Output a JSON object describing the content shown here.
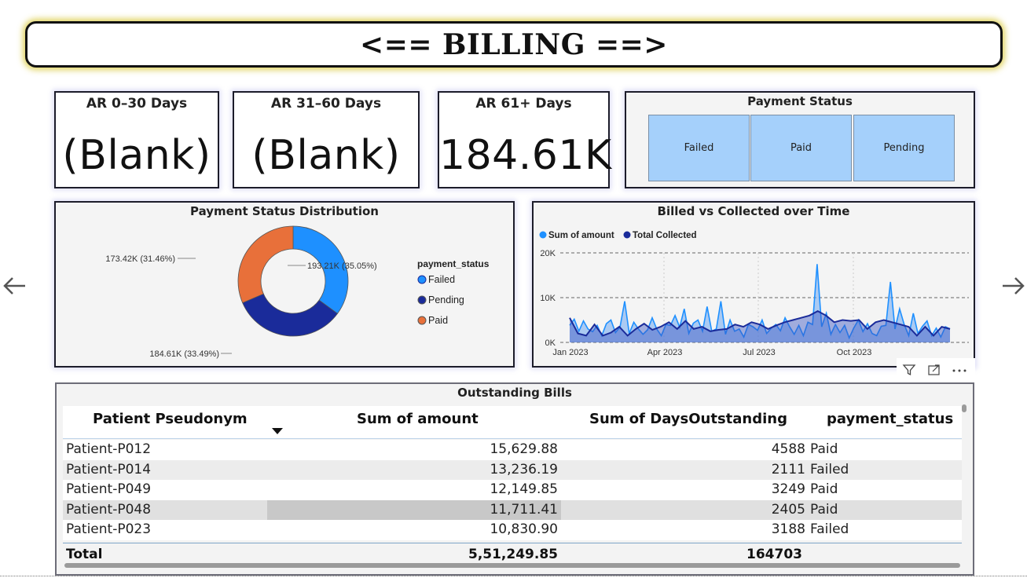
{
  "banner": {
    "title": "<== BILLING ==>"
  },
  "kpis": [
    {
      "label": "AR 0–30 Days",
      "value": "(Blank)"
    },
    {
      "label": "AR 31–60 Days",
      "value": "(Blank)"
    },
    {
      "label": "AR 61+ Days",
      "value": "184.61K"
    }
  ],
  "slicer": {
    "title": "Payment Status",
    "options": [
      "Failed",
      "Paid",
      "Pending"
    ]
  },
  "donut": {
    "title": "Payment Status Distribution",
    "legend_title": "payment_status",
    "labels": {
      "failed": "193.21K (35.05%)",
      "pending": "184.61K (33.49%)",
      "paid": "173.42K (31.46%)"
    },
    "legend": [
      "Failed",
      "Pending",
      "Paid"
    ]
  },
  "line": {
    "title": "Billed vs Collected over Time",
    "legend": [
      "Sum of amount",
      "Total Collected"
    ],
    "y_ticks": [
      "20K",
      "10K",
      "0K"
    ],
    "x_ticks": [
      "Jan 2023",
      "Apr 2023",
      "Jul 2023",
      "Oct 2023"
    ]
  },
  "chart_data": [
    {
      "type": "pie",
      "title": "Payment Status Distribution",
      "categories": [
        "Failed",
        "Pending",
        "Paid"
      ],
      "values": [
        193210,
        184610,
        173420
      ],
      "percent": [
        35.05,
        33.49,
        31.46
      ],
      "colors": [
        "#1e90ff",
        "#1a2b9a",
        "#e8703a"
      ],
      "legend": "right"
    },
    {
      "type": "line",
      "title": "Billed vs Collected over Time",
      "ylim": [
        0,
        20000
      ],
      "grid": true,
      "legend": "top-left",
      "x_range": [
        "2023-01",
        "2023-12"
      ],
      "series": [
        {
          "name": "Sum of amount",
          "color": "#1e90ff",
          "values": [
            3800,
            5200,
            2500,
            4800,
            3000,
            2400,
            3800,
            1500,
            4200,
            5000,
            2200,
            3500,
            9200,
            2000,
            4500,
            3000,
            1800,
            2800,
            5500,
            3000,
            1500,
            4000,
            3800,
            6000,
            3400,
            7500,
            2000,
            4300,
            5000,
            2500,
            8000,
            2500,
            3000,
            9200,
            1800,
            5000,
            2500,
            3000,
            1200,
            4000,
            3500,
            2700,
            5000,
            2000,
            3200,
            4000,
            2600,
            5500,
            3500,
            1800,
            3800,
            1500,
            4500,
            4000,
            17500,
            3500,
            6500,
            1800,
            4000,
            2200,
            3800,
            1000,
            3200,
            5000,
            2400,
            4200,
            2000,
            1500,
            3600,
            3800,
            13500,
            3000,
            7500,
            4000,
            1500,
            6500,
            2000,
            3600,
            4800,
            1500,
            3200,
            1200,
            3500,
            3000
          ]
        },
        {
          "name": "Total Collected",
          "color": "#1a2b9a",
          "values": [
            5500,
            2000,
            1500,
            4000,
            1500,
            2200,
            3500,
            1500,
            3000,
            4200,
            2800,
            3500,
            4500,
            3000,
            4800,
            3000,
            3500,
            2500,
            2800,
            3000,
            4000,
            3500,
            4500,
            4000,
            3000,
            3800,
            4500,
            5000,
            5500,
            6000,
            7000,
            6000,
            4500,
            5000,
            4800,
            5000,
            3000,
            4500,
            5000,
            4500,
            4000,
            3500,
            1500,
            3500,
            1500,
            3500,
            3000
          ]
        }
      ]
    }
  ],
  "table": {
    "title": "Outstanding Bills",
    "columns": [
      "Patient Pseudonym",
      "Sum of amount",
      "Sum of DaysOutstanding",
      "payment_status"
    ],
    "rows": [
      [
        "Patient-P012",
        "15,629.88",
        "4588",
        "Paid"
      ],
      [
        "Patient-P014",
        "13,236.19",
        "2111",
        "Failed"
      ],
      [
        "Patient-P049",
        "12,149.85",
        "3249",
        "Paid"
      ],
      [
        "Patient-P048",
        "11,711.41",
        "2405",
        "Paid"
      ],
      [
        "Patient-P023",
        "10,830.90",
        "3188",
        "Failed"
      ]
    ],
    "total": {
      "label": "Total",
      "amount": "5,51,249.85",
      "days": "164703"
    }
  }
}
